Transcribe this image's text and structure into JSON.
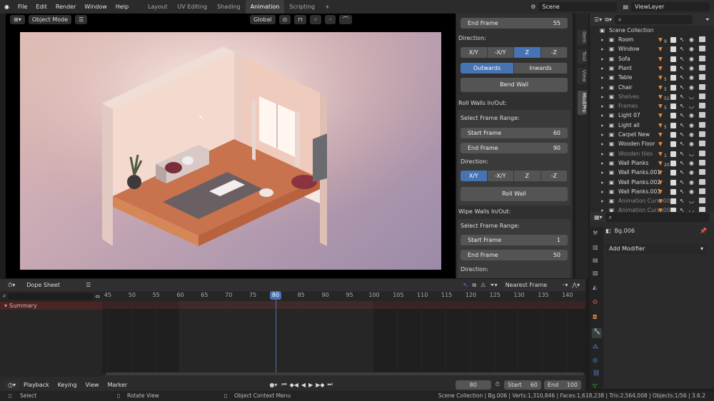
{
  "menus": [
    "File",
    "Edit",
    "Render",
    "Window",
    "Help"
  ],
  "workspaces": [
    "Layout",
    "UV Editing",
    "Shading",
    "Animation",
    "Scripting"
  ],
  "active_workspace": "Animation",
  "add_workspace": "+",
  "scene_name": "Scene",
  "view_layer": "ViewLayer",
  "viewport": {
    "mode": "Object Mode",
    "transform_orientation": "Global"
  },
  "npanel": {
    "end_frame_top_label": "End Frame",
    "end_frame_top_value": "55",
    "direction_label": "Direction:",
    "direction_opts": [
      "X/Y",
      "-X/Y",
      "Z",
      "-Z"
    ],
    "out_in_opts": [
      "Outwards",
      "Inwards"
    ],
    "bend_wall": "Bend Wall",
    "roll_section": "Roll Walls In/Out:",
    "select_range": "Select Frame Range:",
    "start_frame_label": "Start Frame",
    "roll_start": "60",
    "end_frame_label": "End Frame",
    "roll_end": "90",
    "roll_wall": "Roll Wall",
    "wipe_section": "Wipe Walls In/Out:",
    "wipe_start": "1",
    "wipe_end": "50",
    "direction_bottom": "Direction:"
  },
  "npanel_tabs": [
    "Item",
    "Tool",
    "View",
    "ModiPro"
  ],
  "outliner": {
    "root": "Scene Collection",
    "items": [
      {
        "name": "Room",
        "badge": "9"
      },
      {
        "name": "Window",
        "badge": ""
      },
      {
        "name": "Sofa",
        "badge": ""
      },
      {
        "name": "Plant",
        "badge": ""
      },
      {
        "name": "Table",
        "badge": "5"
      },
      {
        "name": "Chair",
        "badge": "5"
      },
      {
        "name": "Shelves",
        "badge": "51"
      },
      {
        "name": "Frames",
        "badge": "5"
      },
      {
        "name": "Light 07",
        "badge": ""
      },
      {
        "name": "Light all",
        "badge": "5"
      },
      {
        "name": "Carpet New",
        "badge": ""
      },
      {
        "name": "Wooden Floor",
        "badge": ""
      },
      {
        "name": "Wooden tiles",
        "badge": "1"
      },
      {
        "name": "Wall Planks",
        "badge": "20"
      },
      {
        "name": "Wall Planks.001",
        "badge": ""
      },
      {
        "name": "Wall Planks.002",
        "badge": ""
      },
      {
        "name": "Wall Planks.003",
        "badge": ""
      },
      {
        "name": "Animation Curve00",
        "badge": ""
      },
      {
        "name": "Animation Curve00",
        "badge": ""
      }
    ]
  },
  "properties": {
    "object_name": "Bg.006",
    "add_modifier": "Add Modifier"
  },
  "dopesheet": {
    "editor": "Dope Sheet",
    "snap": "Nearest Frame",
    "ticks": [
      "45",
      "50",
      "55",
      "60",
      "65",
      "70",
      "75",
      "80",
      "85",
      "90",
      "95",
      "100",
      "105",
      "110",
      "115",
      "120",
      "125",
      "130",
      "135",
      "140"
    ],
    "current": "80",
    "summary": "Summary"
  },
  "timeline": {
    "menus": [
      "Playback",
      "Keying",
      "View",
      "Marker"
    ],
    "frame": "80",
    "start_label": "Start",
    "start": "60",
    "end_label": "End",
    "end": "100"
  },
  "status": {
    "select": "Select",
    "rotate": "Rotate View",
    "context": "Object Context Menu",
    "info": "Scene Collection | Bg.006 | Verts:1,310,846 | Faces:1,618,238 | Tris:2,564,008 | Objects:1/56 | 3.6.2"
  },
  "colors": {
    "accent": "#4772b3",
    "keyframe_orange": "#e08a3c"
  }
}
